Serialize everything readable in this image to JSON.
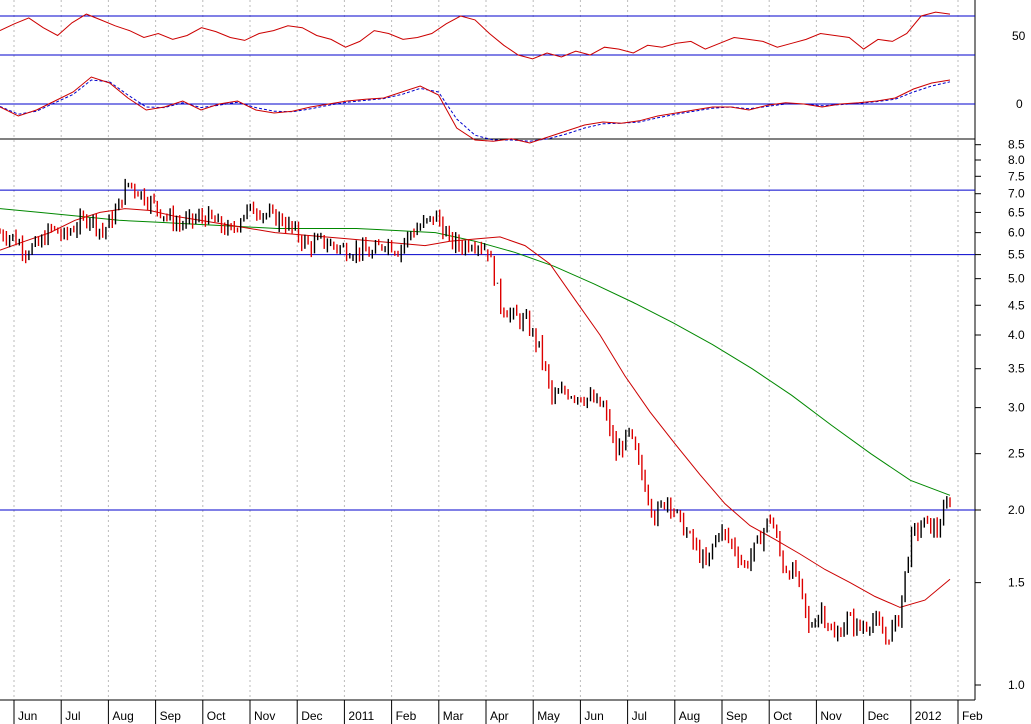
{
  "chart_data": {
    "type": "candlestick",
    "panels": [
      {
        "name": "rsi",
        "y_ticks": [
          "50"
        ],
        "reference_lines": [
          70,
          30
        ],
        "ylim": [
          0,
          100
        ],
        "series": [
          {
            "kind": "line",
            "color": "#cc0000",
            "style": "solid",
            "values": [
              55,
              62,
              68,
              58,
              50,
              63,
              72,
              66,
              60,
              55,
              48,
              52,
              46,
              50,
              58,
              54,
              48,
              45,
              52,
              55,
              60,
              58,
              50,
              46,
              38,
              44,
              55,
              52,
              46,
              48,
              52,
              62,
              70,
              66,
              52,
              40,
              30,
              26,
              32,
              28,
              34,
              30,
              38,
              36,
              32,
              40,
              38,
              42,
              44,
              36,
              42,
              48,
              46,
              44,
              38,
              42,
              46,
              52,
              50,
              48,
              36,
              46,
              44,
              52,
              70,
              74,
              72
            ]
          }
        ]
      },
      {
        "name": "macd",
        "y_ticks": [
          "0"
        ],
        "reference_lines": [
          0
        ],
        "ylim": [
          -1,
          1
        ],
        "series": [
          {
            "kind": "line",
            "color": "#cc0000",
            "style": "solid",
            "values": [
              -0.05,
              -0.2,
              -0.1,
              0.05,
              0.2,
              0.45,
              0.35,
              0.1,
              -0.1,
              -0.05,
              0.05,
              -0.1,
              0,
              0.05,
              -0.1,
              -0.15,
              -0.12,
              -0.05,
              0,
              0.05,
              0.08,
              0.1,
              0.2,
              0.3,
              0.15,
              -0.4,
              -0.6,
              -0.62,
              -0.58,
              -0.65,
              -0.55,
              -0.45,
              -0.35,
              -0.3,
              -0.32,
              -0.28,
              -0.2,
              -0.15,
              -0.1,
              -0.05,
              -0.05,
              -0.1,
              -0.02,
              0.02,
              0,
              -0.05,
              0,
              0.02,
              0.05,
              0.1,
              0.25,
              0.35,
              0.4
            ]
          },
          {
            "kind": "line",
            "color": "#0000cc",
            "style": "dashed",
            "values": [
              -0.04,
              -0.17,
              -0.12,
              0.02,
              0.16,
              0.4,
              0.37,
              0.15,
              -0.05,
              -0.06,
              0.02,
              -0.06,
              -0.02,
              0.03,
              -0.06,
              -0.12,
              -0.13,
              -0.08,
              -0.02,
              0.03,
              0.06,
              0.09,
              0.16,
              0.26,
              0.2,
              -0.25,
              -0.52,
              -0.6,
              -0.6,
              -0.62,
              -0.58,
              -0.5,
              -0.4,
              -0.33,
              -0.32,
              -0.3,
              -0.23,
              -0.17,
              -0.12,
              -0.07,
              -0.05,
              -0.08,
              -0.04,
              0,
              0,
              -0.03,
              -0.01,
              0.01,
              0.04,
              0.08,
              0.2,
              0.3,
              0.37
            ]
          }
        ]
      },
      {
        "name": "price",
        "scale": "log",
        "ylim": [
          0.98,
          9.0
        ],
        "y_ticks": [
          8.5,
          8.0,
          7.5,
          7.0,
          6.5,
          6.0,
          5.5,
          5.0,
          4.5,
          4.0,
          3.5,
          3.0,
          2.5,
          2.0,
          1.5,
          1.0
        ],
        "y_tick_labels": [
          "8.5",
          "8.0",
          "7.5",
          "7.0",
          "6.5",
          "6.0",
          "5.5",
          "5.0",
          "4.5",
          "4.0",
          "3.5",
          "3.0",
          "2.5",
          "2.0",
          "1.5",
          "1.0"
        ],
        "horizontal_lines": [
          7.1,
          5.5,
          2.0
        ],
        "weekly_closes": [
          6.0,
          5.9,
          5.6,
          5.7,
          6.1,
          5.9,
          6.2,
          6.4,
          6.0,
          6.5,
          7.3,
          7.0,
          6.7,
          6.4,
          6.2,
          6.3,
          6.4,
          6.2,
          6.0,
          6.5,
          6.6,
          6.4,
          6.3,
          6.0,
          5.7,
          5.8,
          5.7,
          5.6,
          5.6,
          5.5,
          5.8,
          5.6,
          6.0,
          6.2,
          6.4,
          5.8,
          5.7,
          5.8,
          5.6,
          4.5,
          4.3,
          4.2,
          3.8,
          3.1,
          3.2,
          3.15,
          3.1,
          3.0,
          2.5,
          2.7,
          2.3,
          1.95,
          2.1,
          1.9,
          1.75,
          1.6,
          1.85,
          1.75,
          1.6,
          1.75,
          1.95,
          1.6,
          1.55,
          1.25,
          1.35,
          1.2,
          1.3,
          1.25,
          1.3,
          1.2,
          1.3,
          1.8,
          1.9,
          1.85,
          2.1
        ],
        "moving_averages": [
          {
            "name": "MA red",
            "color": "#cc0000",
            "values": [
              5.6,
              5.8,
              6.0,
              6.3,
              6.5,
              6.6,
              6.55,
              6.4,
              6.3,
              6.2,
              6.1,
              6.0,
              5.95,
              5.9,
              5.85,
              5.8,
              5.75,
              5.7,
              5.8,
              5.85,
              5.9,
              5.7,
              5.3,
              4.6,
              4.0,
              3.4,
              2.95,
              2.6,
              2.3,
              2.05,
              1.88,
              1.78,
              1.68,
              1.58,
              1.5,
              1.42,
              1.36,
              1.4,
              1.52
            ]
          },
          {
            "name": "MA green",
            "color": "#008800",
            "values": [
              6.6,
              6.5,
              6.4,
              6.3,
              6.25,
              6.2,
              6.15,
              6.1,
              6.1,
              6.1,
              6.05,
              6.0,
              5.8,
              5.55,
              5.25,
              4.9,
              4.55,
              4.2,
              3.85,
              3.5,
              3.15,
              2.8,
              2.5,
              2.25,
              2.12
            ]
          }
        ]
      }
    ],
    "x_tick_labels": [
      "Jun",
      "Jul",
      "Aug",
      "Sep",
      "Oct",
      "Nov",
      "Dec",
      "2011",
      "Feb",
      "Mar",
      "Apr",
      "May",
      "Jun",
      "Jul",
      "Aug",
      "Sep",
      "Oct",
      "Nov",
      "Dec",
      "2012",
      "Feb"
    ],
    "up_color": "#000000",
    "down_color": "#dd0000",
    "grid": "vertical-dotted",
    "line_color": "#0000cc"
  }
}
